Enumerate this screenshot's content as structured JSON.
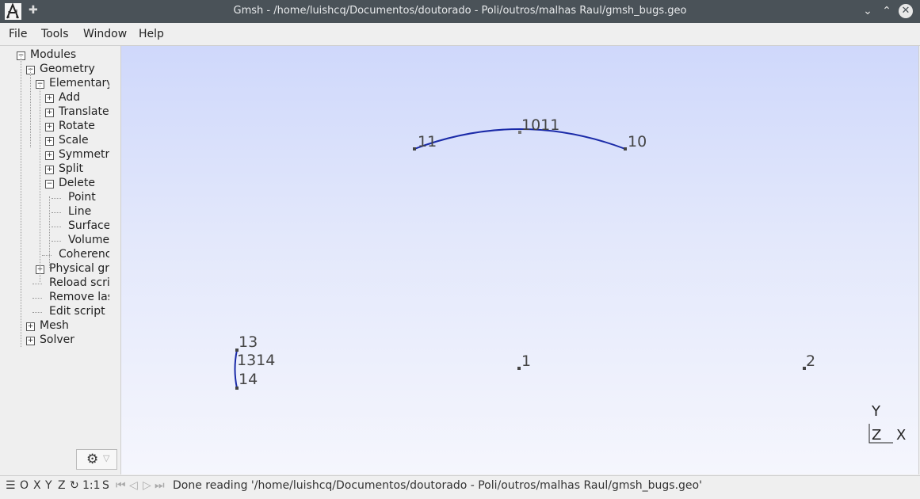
{
  "window": {
    "title": "Gmsh - /home/luishcq/Documentos/doutorado - Poli/outros/malhas Raul/gmsh_bugs.geo"
  },
  "menubar": {
    "items": [
      "File",
      "Tools",
      "Window",
      "Help"
    ]
  },
  "tree": {
    "nodes": [
      {
        "label": "Modules",
        "level": 0,
        "expander": "minus"
      },
      {
        "label": "Geometry",
        "level": 1,
        "expander": "minus"
      },
      {
        "label": "Elementary",
        "level": 2,
        "expander": "minus"
      },
      {
        "label": "Add",
        "level": 3,
        "expander": "plus"
      },
      {
        "label": "Translate",
        "level": 3,
        "expander": "plus"
      },
      {
        "label": "Rotate",
        "level": 3,
        "expander": "plus"
      },
      {
        "label": "Scale",
        "level": 3,
        "expander": "plus"
      },
      {
        "label": "Symmetry",
        "level": 3,
        "expander": "plus"
      },
      {
        "label": "Split",
        "level": 3,
        "expander": "plus"
      },
      {
        "label": "Delete",
        "level": 3,
        "expander": "minus"
      },
      {
        "label": "Point",
        "level": 4,
        "expander": "none"
      },
      {
        "label": "Line",
        "level": 4,
        "expander": "none"
      },
      {
        "label": "Surface",
        "level": 4,
        "expander": "none"
      },
      {
        "label": "Volume",
        "level": 4,
        "expander": "none"
      },
      {
        "label": "Coherence",
        "level": 3,
        "expander": "none"
      },
      {
        "label": "Physical groups",
        "level": 2,
        "expander": "plus"
      },
      {
        "label": "Reload script",
        "level": 2,
        "expander": "none"
      },
      {
        "label": "Remove last",
        "level": 2,
        "expander": "none"
      },
      {
        "label": "Edit script",
        "level": 2,
        "expander": "none"
      },
      {
        "label": "Mesh",
        "level": 1,
        "expander": "plus"
      },
      {
        "label": "Solver",
        "level": 1,
        "expander": "plus"
      }
    ]
  },
  "viewport": {
    "labels": {
      "p11": "11",
      "c1011": "1011",
      "p10": "10",
      "p13": "13",
      "c1314": "1314",
      "p14": "14",
      "p1": "1",
      "p2": "2"
    },
    "axes": {
      "y": "Y",
      "z": "Z",
      "x": "X"
    },
    "curve_color": "#1a2aa8",
    "background_top": "#cfd8fb",
    "background_bottom": "#f5f6fd"
  },
  "statusbar": {
    "menu_icon": "hamburger-icon",
    "o": "O",
    "x": "X",
    "y": "Y",
    "z": "Z",
    "scale": "1:1",
    "s": "S",
    "message": "Done reading '/home/luishcq/Documentos/doutorado - Poli/outros/malhas Raul/gmsh_bugs.geo'"
  }
}
